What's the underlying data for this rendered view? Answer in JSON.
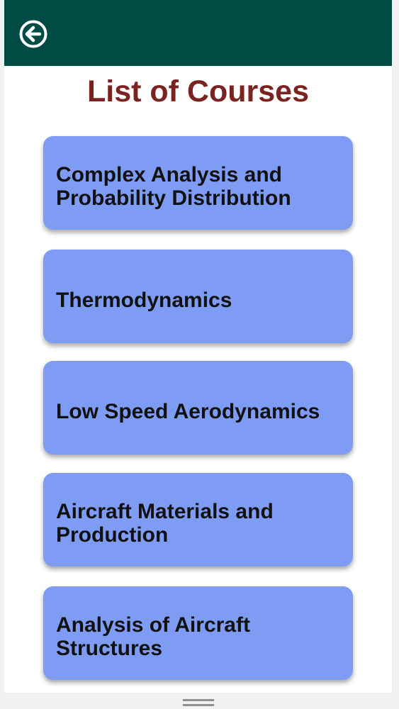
{
  "header": {
    "back_icon": "arrow-left-circle-icon",
    "background_color": "#024b45"
  },
  "page": {
    "title": "List of Courses",
    "title_color": "#7b2321"
  },
  "courses": [
    {
      "label": "Complex Analysis and Probability Distribution"
    },
    {
      "label": "Thermodynamics"
    },
    {
      "label": "Low Speed Aerodynamics"
    },
    {
      "label": "Aircraft Materials and Production"
    },
    {
      "label": "Analysis of Aircraft Structures"
    }
  ],
  "theme": {
    "card_color": "#7f9cf5",
    "card_text_color": "#111111"
  }
}
